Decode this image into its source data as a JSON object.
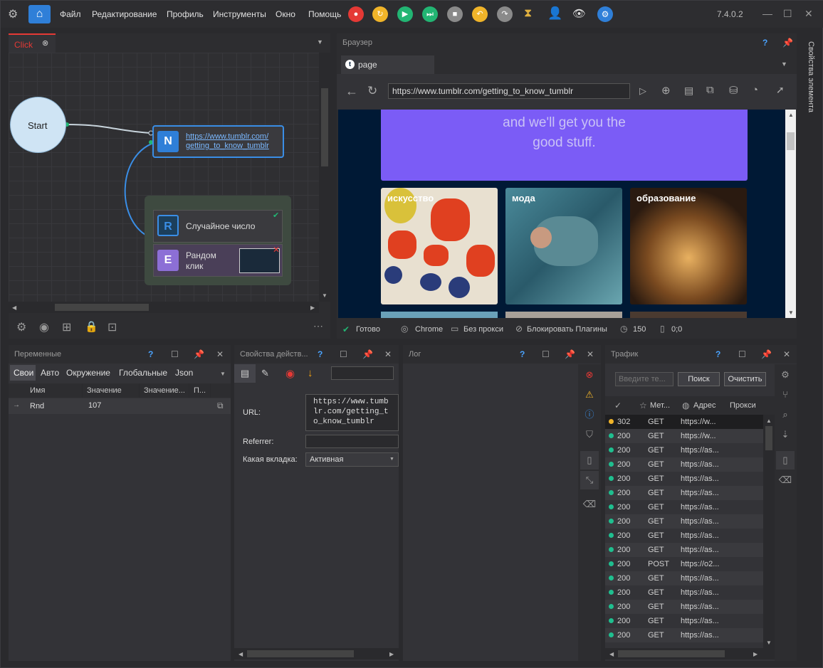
{
  "app": {
    "version": "7.4.0.2"
  },
  "menu": [
    "Файл",
    "Редактирование",
    "Профиль",
    "Инструменты",
    "Окно",
    "Помощь"
  ],
  "toolbar_icons": [
    {
      "name": "record-icon",
      "color": "#e53935",
      "glyph": "●"
    },
    {
      "name": "refresh-icon",
      "color": "#f0b429",
      "glyph": "↻"
    },
    {
      "name": "play-icon",
      "color": "#22b573",
      "glyph": "▶"
    },
    {
      "name": "step-icon",
      "color": "#22b573",
      "glyph": "⏭"
    },
    {
      "name": "stop-icon",
      "color": "#8a8a8a",
      "glyph": "■"
    },
    {
      "name": "undo-icon",
      "color": "#f0b429",
      "glyph": "↶"
    },
    {
      "name": "redo-icon",
      "color": "#8a8a8a",
      "glyph": "↷"
    }
  ],
  "project": {
    "tab": "Click",
    "start_label": "Start",
    "node_n": {
      "letter": "N",
      "line1": "https://www.tumblr.com/",
      "line2": "getting_to_know_tumblr"
    },
    "node_r": {
      "letter": "R",
      "label": "Случайное число"
    },
    "node_e": {
      "letter": "E",
      "line1": "Рандом",
      "line2": "клик"
    }
  },
  "browser": {
    "title": "Браузер",
    "tab": "page",
    "url": "https://www.tumblr.com/getting_to_know_tumblr",
    "page": {
      "banner_line1": "and we'll get you the",
      "banner_line2": "good stuff.",
      "tiles": [
        "искусство",
        "мода",
        "образование"
      ]
    },
    "status": {
      "ready": "Готово",
      "engine": "Chrome",
      "proxy": "Без прокси",
      "plugins": "Блокировать Плагины",
      "zoom": "150",
      "coords": "0;0"
    }
  },
  "side_tab": "Свойства элемента",
  "variables": {
    "title": "Переменные",
    "tabs": [
      "Свои",
      "Авто",
      "Окружение",
      "Глобальные",
      "Json"
    ],
    "cols": [
      "Имя",
      "Значение",
      "Значение...",
      "П..."
    ],
    "rows": [
      {
        "name": "Rnd",
        "value": "107"
      }
    ]
  },
  "props": {
    "title": "Свойства действ...",
    "url_label": "URL:",
    "url_value": "https://www.tumblr.com/getting_to_know_tumblr",
    "referrer_label": "Referrer:",
    "tab_label": "Какая вкладка:",
    "tab_value": "Активная"
  },
  "log": {
    "title": "Лог"
  },
  "traffic": {
    "title": "Трафик",
    "filter_placeholder": "Введите те...",
    "search": "Поиск",
    "clear": "Очистить",
    "cols": [
      "Мет...",
      "Адрес",
      "Прокси"
    ],
    "rows": [
      {
        "code": "302",
        "method": "GET",
        "url": "https://w...",
        "status": "warn"
      },
      {
        "code": "200",
        "method": "GET",
        "url": "https://w...",
        "status": "ok"
      },
      {
        "code": "200",
        "method": "GET",
        "url": "https://as...",
        "status": "ok"
      },
      {
        "code": "200",
        "method": "GET",
        "url": "https://as...",
        "status": "ok"
      },
      {
        "code": "200",
        "method": "GET",
        "url": "https://as...",
        "status": "ok"
      },
      {
        "code": "200",
        "method": "GET",
        "url": "https://as...",
        "status": "ok"
      },
      {
        "code": "200",
        "method": "GET",
        "url": "https://as...",
        "status": "ok"
      },
      {
        "code": "200",
        "method": "GET",
        "url": "https://as...",
        "status": "ok"
      },
      {
        "code": "200",
        "method": "GET",
        "url": "https://as...",
        "status": "ok"
      },
      {
        "code": "200",
        "method": "GET",
        "url": "https://as...",
        "status": "ok"
      },
      {
        "code": "200",
        "method": "POST",
        "url": "https://o2...",
        "status": "ok"
      },
      {
        "code": "200",
        "method": "GET",
        "url": "https://as...",
        "status": "ok"
      },
      {
        "code": "200",
        "method": "GET",
        "url": "https://as...",
        "status": "ok"
      },
      {
        "code": "200",
        "method": "GET",
        "url": "https://as...",
        "status": "ok"
      },
      {
        "code": "200",
        "method": "GET",
        "url": "https://as...",
        "status": "ok"
      },
      {
        "code": "200",
        "method": "GET",
        "url": "https://as...",
        "status": "ok"
      }
    ]
  },
  "colors": {
    "ok": "#1fbf8f",
    "warn": "#f0b429",
    "accent": "#3a8ee6",
    "banner": "#7b5cf6"
  }
}
